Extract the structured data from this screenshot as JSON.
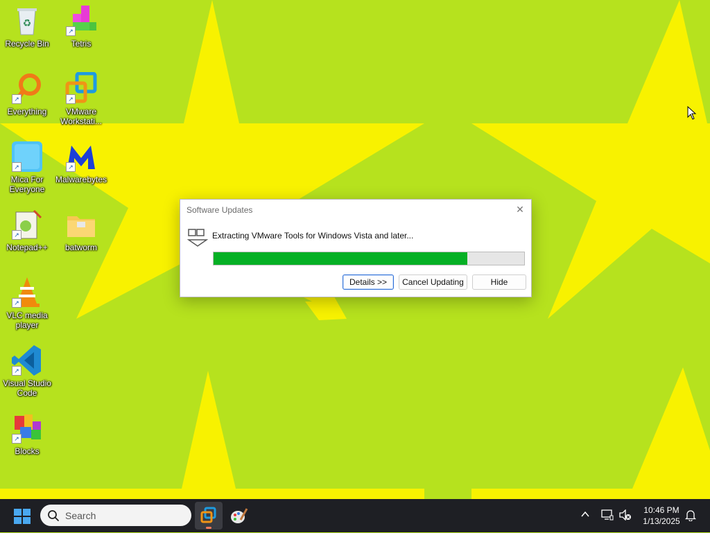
{
  "desktop": {
    "icons": [
      {
        "label": "Recycle Bin"
      },
      {
        "label": "Tetris"
      },
      {
        "label": "Everything"
      },
      {
        "label": "VMware Workstati..."
      },
      {
        "label": "Mica For Everyone"
      },
      {
        "label": "Malwarebytes"
      },
      {
        "label": "Notepad++"
      },
      {
        "label": "batworm"
      },
      {
        "label": "VLC media player"
      },
      {
        "label": "Visual Studio Code"
      },
      {
        "label": "Blocks"
      }
    ]
  },
  "dialog": {
    "title": "Software Updates",
    "message": "Extracting VMware Tools for Windows Vista and later...",
    "progress_fraction": 0.818,
    "buttons": {
      "details": "Details >>",
      "cancel": "Cancel Updating",
      "hide": "Hide"
    }
  },
  "taskbar": {
    "search_placeholder": "Search",
    "time": "10:46 PM",
    "date": "1/13/2025"
  },
  "colors": {
    "wallpaper_green": "#b6e21e",
    "wallpaper_star": "#f8f200",
    "progress": "#06b025",
    "taskbar": "#1e1f24"
  }
}
